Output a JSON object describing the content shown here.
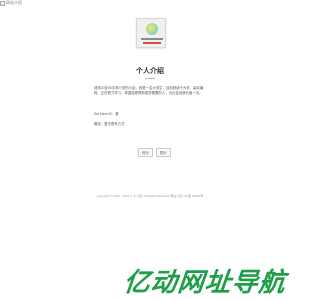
{
  "header": {
    "logo_alt": "网站介绍"
  },
  "profile_card": {
    "icon_name": "profile-badge-image"
  },
  "main": {
    "title": "个人介绍",
    "paragraph1": "请用20至50字简介您的小站，我是一名大学生，目前就读于大学，喜欢编程，正在努力学习，希望能够帮助更多需要的人，为社会创造价值一天。",
    "paragraph2": "Set Mem ID：爱",
    "paragraph3": "微信：暂无联系方式"
  },
  "pager": {
    "prev_label": "首页",
    "next_label": "尾页"
  },
  "footer": {
    "text": "Copyright © 2021 - 2025 个人介绍 All Rights Reserved 网站介绍 ICP备 00000号"
  },
  "watermark": {
    "text": "亿动网址导航"
  },
  "colors": {
    "accent_green": "#1e9e47",
    "card_red": "#d94a3a"
  }
}
